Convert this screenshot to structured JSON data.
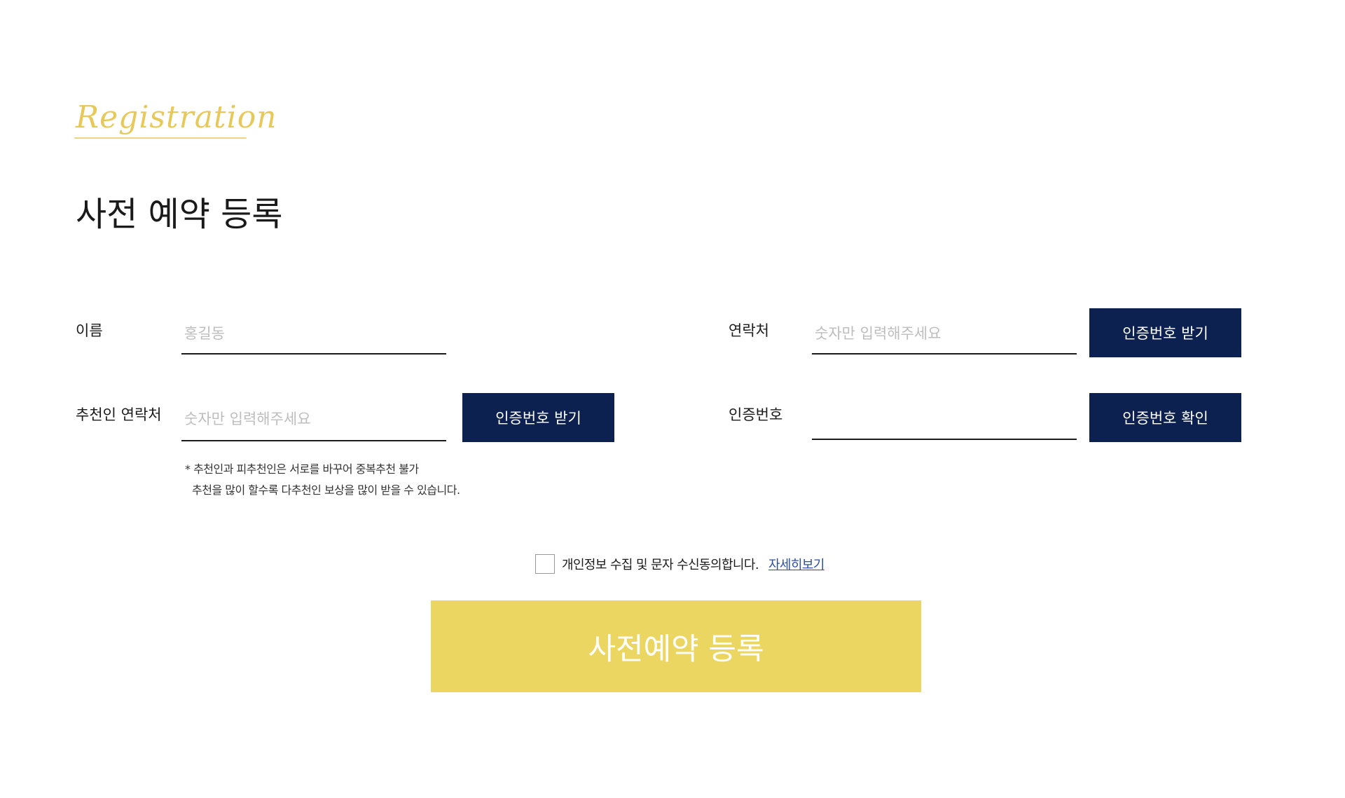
{
  "header": {
    "script_title": "Registration",
    "page_title": "사전 예약 등록"
  },
  "form": {
    "name": {
      "label": "이름",
      "placeholder": "홍길동",
      "value": ""
    },
    "contact": {
      "label": "연락처",
      "placeholder": "숫자만 입력해주세요",
      "value": "",
      "button_label": "인증번호 받기"
    },
    "referrer_contact": {
      "label": "추천인 연락처",
      "placeholder": "숫자만 입력해주세요",
      "value": "",
      "button_label": "인증번호 받기"
    },
    "verification_code": {
      "label": "인증번호",
      "placeholder": "",
      "value": "",
      "button_label": "인증번호 확인"
    },
    "note": {
      "line1": "* 추천인과 피추천인은 서로를 바꾸어 중복추천 불가",
      "line2": "추천을 많이 할수록 다추천인 보상을 많이 받을 수 있습니다."
    }
  },
  "agreement": {
    "checked": false,
    "text": "개인정보 수집 및 문자 수신동의합니다.",
    "link_label": "자세히보기"
  },
  "submit": {
    "label": "사전예약 등록"
  },
  "colors": {
    "accent_gold": "#ecd662",
    "script_gold": "#e6c95a",
    "navy": "#0d2150",
    "link_blue": "#2a4fa8",
    "placeholder_gray": "#bdbdbd"
  }
}
